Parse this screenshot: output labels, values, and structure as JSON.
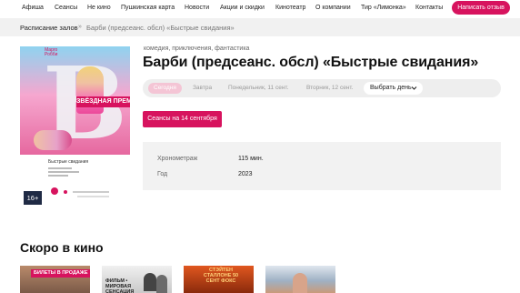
{
  "nav": {
    "items": [
      "Афиша",
      "Сеансы",
      "Не кино",
      "Пушкинская карта",
      "Новости",
      "Акции и скидки",
      "Кинотеатр",
      "О компании",
      "Тир «Лимонка»",
      "Контакты"
    ],
    "write_button": "Написать отзыв"
  },
  "breadcrumb": {
    "root": "Расписание залов",
    "separator": "»",
    "current": "Барби (предсеанс. обсл) «Быстрые свидания»"
  },
  "poster": {
    "brand_line1": "Марго",
    "brand_line2": "Робби",
    "premiere_badge": "ЗВЁЗДНАЯ ПРЕМЬЕРА",
    "card_title": "Быстрые свидания",
    "age_rating": "16+"
  },
  "movie": {
    "genres": "комедия, приключения, фантастика",
    "title": "Барби (предсеанс. обсл) «Быстрые свидания»"
  },
  "days": {
    "items": [
      {
        "label": "Сегодня",
        "active": true
      },
      {
        "label": "Завтра",
        "active": false
      },
      {
        "label": "Понедельник, 11 сент.",
        "active": false
      },
      {
        "label": "Вторник, 12 сент.",
        "active": false
      }
    ],
    "picker_label": "Выбрать день"
  },
  "sessions_button": "Сеансы на 14 сентября",
  "info": {
    "duration_label": "Хронометраж",
    "duration_value": "115 мин.",
    "year_label": "Год",
    "year_value": "2023"
  },
  "soon": {
    "heading": "Скоро в кино",
    "thumbs": [
      {
        "tag": "БИЛЕТЫ В ПРОДАЖЕ",
        "text": ""
      },
      {
        "tag": "",
        "text": "ФИЛЬМ • МИРОВАЯ СЕНСАЦИЯ"
      },
      {
        "tag": "",
        "text": "СТЭЙТЕН СТАЛЛОНЕ 50 СЕНТ ФОКС"
      },
      {
        "tag": "",
        "text": ""
      }
    ]
  },
  "colors": {
    "accent": "#d7135e",
    "panel": "#f2f2f2"
  }
}
